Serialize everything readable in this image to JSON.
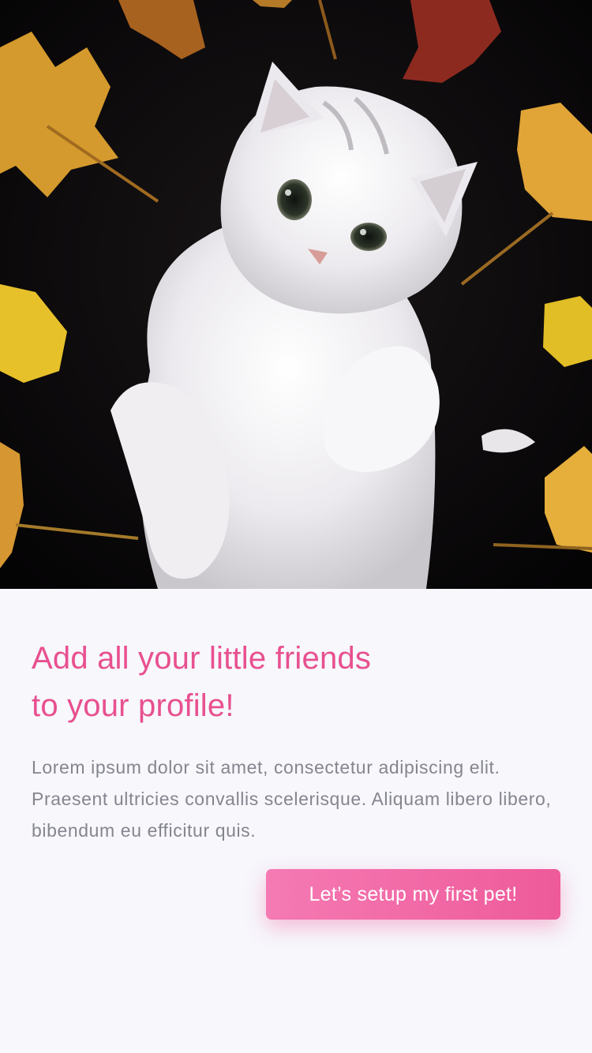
{
  "hero": {
    "image": "white-kitten-on-dark-background-with-autumn-leaves"
  },
  "onboarding": {
    "title_line1": "Add all your little friends",
    "title_line2": "to your profile!",
    "description": "Lorem ipsum dolor sit amet, consectetur adipiscing elit. Praesent ultricies convallis scelerisque. Aliquam libero libero, bibendum eu efficitur quis.",
    "cta_label": "Let’s setup my first pet!"
  },
  "colors": {
    "accent": "#e8508f",
    "button_start": "#f57ab3",
    "button_end": "#ee5a9a",
    "background": "#f7f7fc",
    "body_text": "#85858f"
  }
}
